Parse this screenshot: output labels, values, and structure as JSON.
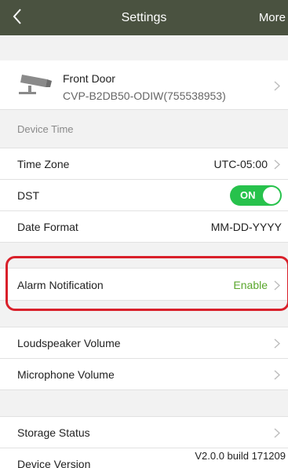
{
  "header": {
    "title": "Settings",
    "more_label": "More"
  },
  "device": {
    "name": "Front Door",
    "model": "CVP-B2DB50-ODIW(755538953)"
  },
  "sections": {
    "device_time_header": "Device Time"
  },
  "rows": {
    "time_zone": {
      "label": "Time Zone",
      "value": "UTC-05:00"
    },
    "dst": {
      "label": "DST",
      "toggle": "ON"
    },
    "date_format": {
      "label": "Date Format",
      "value": "MM-DD-YYYY"
    },
    "alarm_notification": {
      "label": "Alarm Notification",
      "value": "Enable"
    },
    "loudspeaker_volume": {
      "label": "Loudspeaker Volume"
    },
    "microphone_volume": {
      "label": "Microphone Volume"
    },
    "storage_status": {
      "label": "Storage Status"
    },
    "device_version": {
      "label": "Device Version",
      "value": "V2.0.0 build 171209"
    }
  },
  "colors": {
    "header_bg": "#4a5240",
    "accent_green": "#27c24c",
    "enable_text": "#5aa72c",
    "highlight_red": "#d9202a"
  },
  "icons": {
    "back": "chevron-left-icon",
    "device": "security-camera-icon",
    "row_arrow": "chevron-right-icon"
  }
}
